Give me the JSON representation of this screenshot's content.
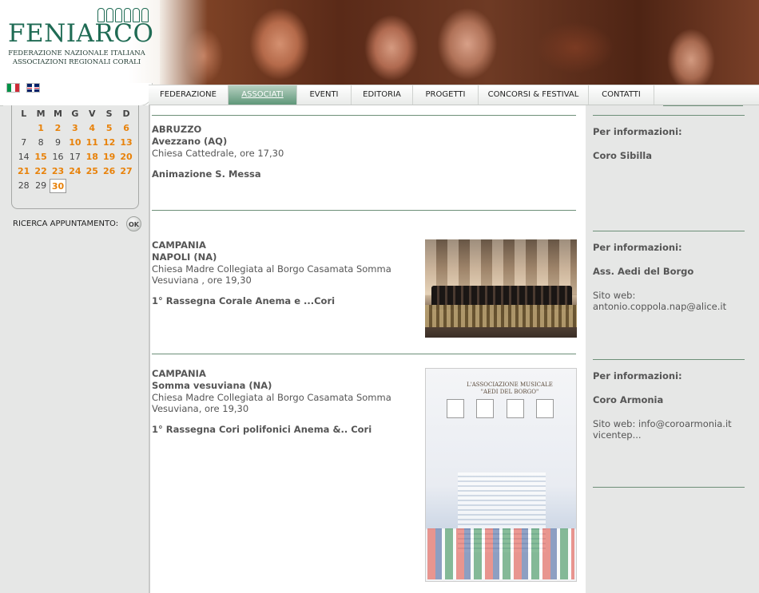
{
  "header": {
    "logo_text": "FENIARCO",
    "logo_sub_1": "FEDERAZIONE NAZIONALE ITALIANA",
    "logo_sub_2": "ASSOCIAZIONI REGIONALI CORALI"
  },
  "nav": {
    "items": [
      {
        "label": "FEDERAZIONE",
        "active": false
      },
      {
        "label": "ASSOCIATI",
        "active": true
      },
      {
        "label": "EVENTI",
        "active": false
      },
      {
        "label": "EDITORIA",
        "active": false
      },
      {
        "label": "PROGETTI",
        "active": false
      },
      {
        "label": "CONCORSI & FESTIVAL",
        "active": false
      },
      {
        "label": "CONTATTI",
        "active": false
      }
    ]
  },
  "calendar": {
    "days_header": [
      "L",
      "M",
      "M",
      "G",
      "V",
      "S",
      "D"
    ],
    "weeks": [
      [
        "",
        "1",
        "2",
        "3",
        "4",
        "5",
        "6"
      ],
      [
        "7",
        "8",
        "9",
        "10",
        "11",
        "12",
        "13"
      ],
      [
        "14",
        "15",
        "16",
        "17",
        "18",
        "19",
        "20"
      ],
      [
        "21",
        "22",
        "23",
        "24",
        "25",
        "26",
        "27"
      ],
      [
        "28",
        "29",
        "30",
        "",
        "",
        "",
        ""
      ]
    ],
    "event_days": [
      "1",
      "2",
      "3",
      "4",
      "5",
      "6",
      "10",
      "11",
      "12",
      "13",
      "15",
      "18",
      "19",
      "20",
      "21",
      "22",
      "23",
      "24",
      "25",
      "26",
      "27",
      "30"
    ],
    "today": "30"
  },
  "search": {
    "label": "RICERCA APPUNTAMENTO:",
    "ok_label": "OK"
  },
  "events": [
    {
      "region": "ABRUZZO",
      "city": "Avezzano (AQ)",
      "place": "Chiesa Cattedrale, ore 17,30",
      "title": "Animazione S. Messa",
      "info_label": "Per informazioni:",
      "coro": "Coro Sibilla",
      "web": ""
    },
    {
      "region": "CAMPANIA",
      "city": "NAPOLI (NA)",
      "place": "Chiesa Madre Collegiata al Borgo Casamata Somma Vesuviana , ore 19,30",
      "title": "1° Rassegna Corale Anema e ...Cori",
      "info_label": "Per informazioni:",
      "coro": "Ass. Aedi del Borgo",
      "web": "Sito web: antonio.coppola.nap@alice.it"
    },
    {
      "region": "CAMPANIA",
      "city": "Somma vesuviana (NA)",
      "place": "Chiesa Madre Collegiata al Borgo Casamata Somma Vesuviana, ore 19,30",
      "title": "1° Rassegna Cori polifonici Anema &.. Cori",
      "info_label": "Per informazioni:",
      "coro": "Coro Armonia",
      "web": "Sito web: info@coroarmonia.it vicentep..."
    }
  ],
  "poster": {
    "title_line_1": "L'ASSOCIAZIONE MUSICALE",
    "title_line_2": "\"AEDI DEL BORGO\""
  }
}
